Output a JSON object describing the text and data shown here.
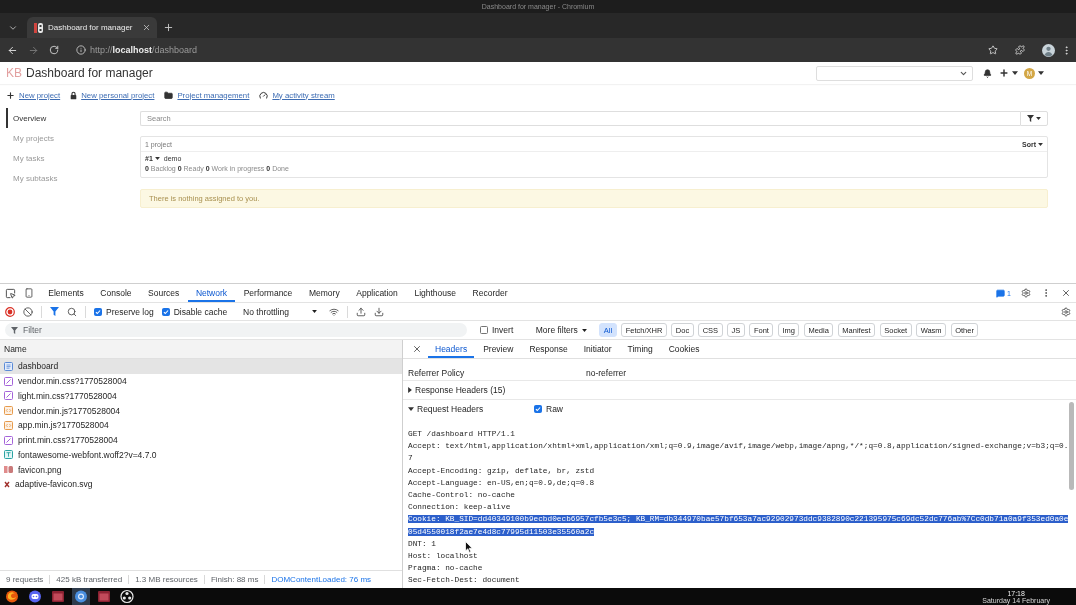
{
  "window": {
    "title": "Dashboard for manager - Chromium"
  },
  "browser": {
    "tabs": [
      {
        "title": "Dashboard for manager",
        "selected": true
      }
    ],
    "url": "http://**localhost**/dashboard"
  },
  "page": {
    "header": {
      "logo": "KB",
      "title": "Dashboard for manager",
      "avatar": "M"
    },
    "actions": [
      {
        "kind": "plus",
        "label": "New project"
      },
      {
        "kind": "lock",
        "label": "New personal project"
      },
      {
        "kind": "folder",
        "label": "Project management"
      },
      {
        "kind": "dashboard",
        "label": "My activity stream"
      }
    ],
    "sidebar": {
      "items": [
        {
          "label": "Overview",
          "selected": true
        },
        {
          "label": "My projects",
          "selected": false
        },
        {
          "label": "My tasks",
          "selected": false
        },
        {
          "label": "My subtasks",
          "selected": false
        }
      ]
    },
    "search": {
      "placeholder": "Search"
    },
    "projects": {
      "count": "1 project",
      "sort": "Sort",
      "items": [
        {
          "id": "#1",
          "name": "demo",
          "stats": "**0** Backlog **0** Ready **0** Work in progress **0** Done"
        }
      ]
    },
    "alert": "There is nothing assigned to you."
  },
  "devtools": {
    "tabs": [
      {
        "label": "Elements",
        "selected": false
      },
      {
        "label": "Console",
        "selected": false
      },
      {
        "label": "Sources",
        "selected": false
      },
      {
        "label": "Network",
        "selected": true
      },
      {
        "label": "Performance",
        "selected": false
      },
      {
        "label": "Memory",
        "selected": false
      },
      {
        "label": "Application",
        "selected": false
      },
      {
        "label": "Lighthouse",
        "selected": false
      },
      {
        "label": "Recorder",
        "selected": false
      }
    ],
    "issues_count": "1",
    "toolbar": {
      "recording": true,
      "preserve_log": {
        "label": "Preserve log",
        "checked": true
      },
      "disable_cache": {
        "label": "Disable cache",
        "checked": true
      },
      "throttling": "No throttling"
    },
    "filter": {
      "placeholder": "Filter",
      "invert": {
        "label": "Invert",
        "checked": false
      },
      "more_filters": "More filters",
      "types": [
        {
          "label": "All",
          "selected": true
        },
        {
          "label": "Fetch/XHR",
          "selected": false
        },
        {
          "label": "Doc",
          "selected": false
        },
        {
          "label": "CSS",
          "selected": false
        },
        {
          "label": "JS",
          "selected": false
        },
        {
          "label": "Font",
          "selected": false
        },
        {
          "label": "Img",
          "selected": false
        },
        {
          "label": "Media",
          "selected": false
        },
        {
          "label": "Manifest",
          "selected": false
        },
        {
          "label": "Socket",
          "selected": false
        },
        {
          "label": "Wasm",
          "selected": false
        },
        {
          "label": "Other",
          "selected": false
        }
      ]
    },
    "requests": {
      "column": "Name",
      "rows": [
        {
          "name": "dashboard",
          "kind": "document",
          "selected": true
        },
        {
          "name": "vendor.min.css?1770528004",
          "kind": "stylesheet",
          "selected": false
        },
        {
          "name": "light.min.css?1770528004",
          "kind": "stylesheet",
          "selected": false
        },
        {
          "name": "vendor.min.js?1770528004",
          "kind": "script",
          "selected": false
        },
        {
          "name": "app.min.js?1770528004",
          "kind": "script",
          "selected": false
        },
        {
          "name": "print.min.css?1770528004",
          "kind": "stylesheet",
          "selected": false
        },
        {
          "name": "fontawesome-webfont.woff2?v=4.7.0",
          "kind": "font",
          "selected": false
        },
        {
          "name": "favicon.png",
          "kind": "png",
          "selected": false
        },
        {
          "name": "adaptive-favicon.svg",
          "kind": "svg",
          "selected": false
        }
      ]
    },
    "status_bar": [
      {
        "text": "9 requests",
        "kind": "metric"
      },
      {
        "text": "425 kB transferred",
        "kind": "metric"
      },
      {
        "text": "1.3 MB resources",
        "kind": "metric"
      },
      {
        "text": "Finish: 88 ms",
        "kind": "metric"
      },
      {
        "text": "DOMContentLoaded: 76 ms",
        "kind": "event"
      }
    ],
    "details": {
      "tabs": [
        {
          "label": "Headers",
          "selected": true
        },
        {
          "label": "Preview",
          "selected": false
        },
        {
          "label": "Response",
          "selected": false
        },
        {
          "label": "Initiator",
          "selected": false
        },
        {
          "label": "Timing",
          "selected": false
        },
        {
          "label": "Cookies",
          "selected": false
        }
      ],
      "general": [
        {
          "key": "Referrer Policy",
          "value": "no-referrer"
        }
      ],
      "sections": [
        {
          "title": "Response Headers (15)",
          "expanded": false
        },
        {
          "title": "Request Headers",
          "expanded": true,
          "raw": {
            "label": "Raw",
            "checked": true
          },
          "lines": [
            {
              "text": "GET /dashboard HTTP/1.1",
              "highlighted": false
            },
            {
              "text": "Accept: text/html,application/xhtml+xml,application/xml;q=0.9,image/avif,image/webp,image/apng,*/*;q=0.8,application/signed-exchange;v=b3;q=0.7",
              "highlighted": false
            },
            {
              "text": "Accept-Encoding: gzip, deflate, br, zstd",
              "highlighted": false
            },
            {
              "text": "Accept-Language: en-US,en;q=0.9,de;q=0.8",
              "highlighted": false
            },
            {
              "text": "Cache-Control: no-cache",
              "highlighted": false
            },
            {
              "text": "Connection: keep-alive",
              "highlighted": false
            },
            {
              "text": "Cookie: KB_SID=dd40349100b9ecbd0ecb6957cfb5e3c5; KB_RM=db344970bae57bf653a7ac92902973ddc9382890c221395975c69dc52dc776ab%7Cc0db71a0a9f353ed0a0e05d4550018f2ae7e4d8c77995d11503e35560a2c",
              "highlighted": true
            },
            {
              "text": "DNT: 1",
              "highlighted": false
            },
            {
              "text": "Host: localhost",
              "highlighted": false
            },
            {
              "text": "Pragma: no-cache",
              "highlighted": false
            },
            {
              "text": "Sec-Fetch-Dest: document",
              "highlighted": false
            }
          ]
        }
      ]
    }
  },
  "taskbar": {
    "apps": [
      {
        "kind": "swirl",
        "active": false
      },
      {
        "kind": "chat",
        "active": false
      },
      {
        "kind": "window",
        "active": false
      },
      {
        "kind": "globe",
        "active": true
      },
      {
        "kind": "window",
        "active": false
      },
      {
        "kind": "ring",
        "active": false
      }
    ],
    "time": "17:18",
    "date": "Saturday 14 February"
  }
}
